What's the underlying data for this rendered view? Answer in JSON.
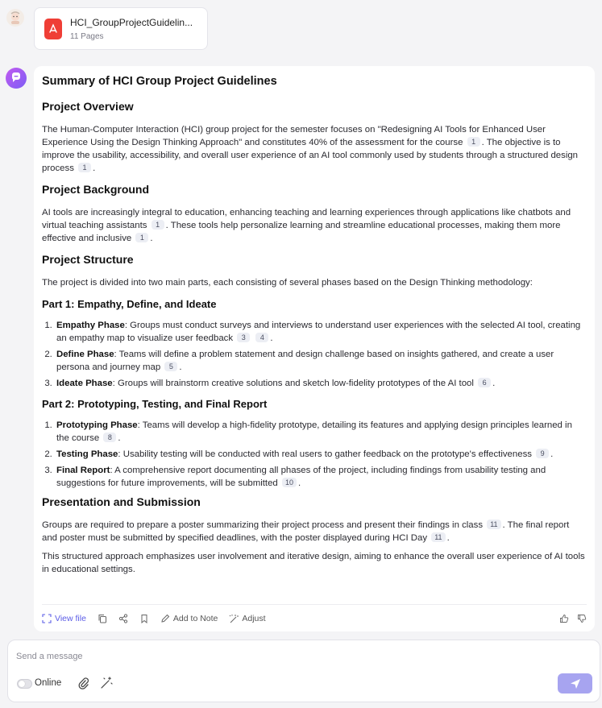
{
  "attachment": {
    "file_name": "HCI_GroupProjectGuidelin...",
    "pages": "11 Pages",
    "icon": "pdf-icon"
  },
  "answer": {
    "title": "Summary of HCI Group Project Guidelines",
    "overview": {
      "heading": "Project Overview",
      "p1_a": "The Human-Computer Interaction (HCI) group project for the semester focuses on \"Redesigning AI Tools for Enhanced User Experience Using the Design Thinking Approach\" and constitutes 40% of the assessment for the course",
      "p1_c1": "1",
      "p1_b": ". The objective is to improve the usability, accessibility, and overall user experience of an AI tool commonly used by students through a structured design process",
      "p1_c2": "1",
      "p1_end": "."
    },
    "background": {
      "heading": "Project Background",
      "p_a": "AI tools are increasingly integral to education, enhancing teaching and learning experiences through applications like chatbots and virtual teaching assistants",
      "p_c1": "1",
      "p_b": ". These tools help personalize learning and streamline educational processes, making them more effective and inclusive",
      "p_c2": "1",
      "p_end": "."
    },
    "structure": {
      "heading": "Project Structure",
      "intro": "The project is divided into two main parts, each consisting of several phases based on the Design Thinking methodology:",
      "part1": {
        "heading": "Part 1: Empathy, Define, and Ideate",
        "items": [
          {
            "term": "Empathy Phase",
            "text": ": Groups must conduct surveys and interviews to understand user experiences with the selected AI tool, creating an empathy map to visualize user feedback",
            "c1": "3",
            "c2": "4",
            "end": "."
          },
          {
            "term": "Define Phase",
            "text": ": Teams will define a problem statement and design challenge based on insights gathered, and create a user persona and journey map",
            "c1": "5",
            "end": "."
          },
          {
            "term": "Ideate Phase",
            "text": ": Groups will brainstorm creative solutions and sketch low-fidelity prototypes of the AI tool",
            "c1": "6",
            "end": "."
          }
        ]
      },
      "part2": {
        "heading": "Part 2: Prototyping, Testing, and Final Report",
        "items": [
          {
            "term": "Prototyping Phase",
            "text": ": Teams will develop a high-fidelity prototype, detailing its features and applying design principles learned in the course",
            "c1": "8",
            "end": "."
          },
          {
            "term": "Testing Phase",
            "text": ": Usability testing will be conducted with real users to gather feedback on the prototype's effectiveness",
            "c1": "9",
            "end": "."
          },
          {
            "term": "Final Report",
            "text": ": A comprehensive report documenting all phases of the project, including findings from usability testing and suggestions for future improvements, will be submitted",
            "c1": "10",
            "end": "."
          }
        ]
      }
    },
    "presentation": {
      "heading": "Presentation and Submission",
      "p1_a": "Groups are required to prepare a poster summarizing their project process and present their findings in class",
      "p1_c1": "11",
      "p1_b": ". The final report and poster must be submitted by specified deadlines, with the poster displayed during HCI Day",
      "p1_c2": "11",
      "p1_end": ".",
      "p2": "This structured approach emphasizes user involvement and iterative design, aiming to enhance the overall user experience of AI tools in educational settings."
    }
  },
  "actions": {
    "view_file": "View file",
    "add_to_note": "Add to Note",
    "adjust": "Adjust"
  },
  "composer": {
    "placeholder": "Send a message",
    "online_label": "Online"
  },
  "colors": {
    "accent": "#5b5ce6",
    "send_button": "#a7a4f0",
    "pdf_red": "#ef3e36"
  }
}
